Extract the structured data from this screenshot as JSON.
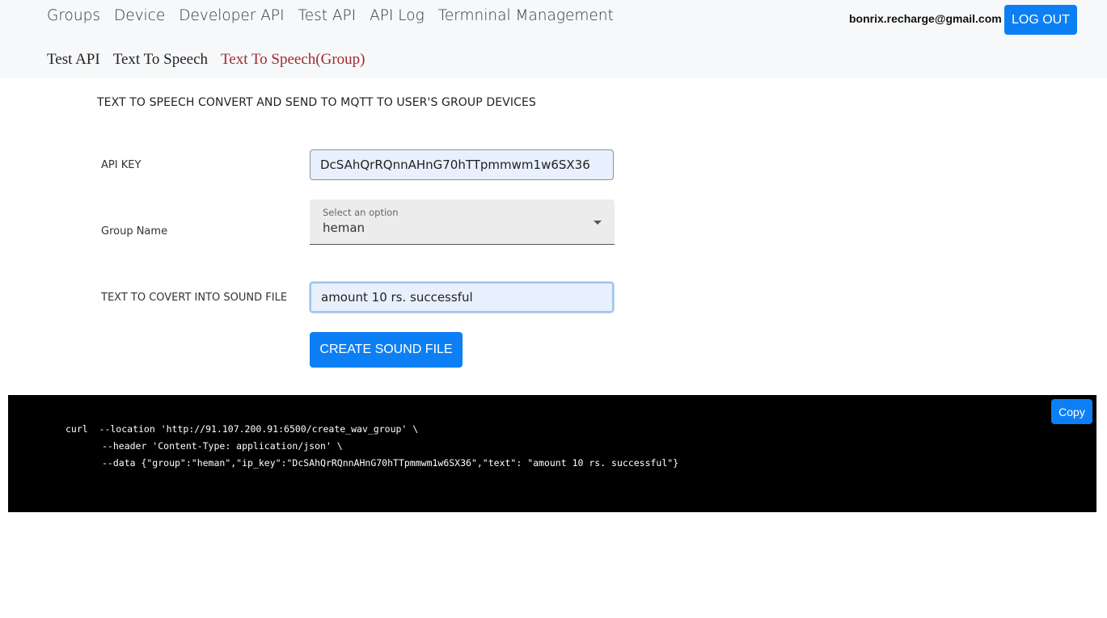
{
  "nav": {
    "main": [
      "Groups",
      "Device",
      "Developer API",
      "Test API",
      "API Log",
      "Termninal Management"
    ],
    "sub": [
      "Test API",
      "Text To Speech",
      "Text To Speech(Group)"
    ],
    "user_email": "bonrix.recharge@gmail.com",
    "logout_label": "LOG OUT"
  },
  "page": {
    "title": "TEXT TO SPEECH CONVERT AND SEND TO MQTT TO USER'S GROUP DEVICES"
  },
  "form": {
    "api_key_label": "API KEY",
    "api_key_value": "DcSAhQrRQnnAHnG70hTTpmmwm1w6SX36",
    "group_label": "Group Name",
    "group_hint": "Select an option",
    "group_value": "heman",
    "text_label": "TEXT TO COVERT INTO SOUND FILE",
    "text_value": "amount 10 rs. successful",
    "create_label": "CREATE SOUND FILE"
  },
  "code": {
    "line1": "curl  --location 'http://91.107.200.91:6500/create_wav_group' \\",
    "line2": "--header 'Content-Type: application/json' \\",
    "line3": "--data {\"group\":\"heman\",\"ip_key\":\"DcSAhQrRQnnAHnG70hTTpmmwm1w6SX36\",\"text\": \"amount 10 rs. successful\"}",
    "copy_label": "Copy"
  },
  "colors": {
    "accent": "#0d7ff5",
    "active_subnav": "#a02a2a",
    "code_bg": "#000000"
  }
}
